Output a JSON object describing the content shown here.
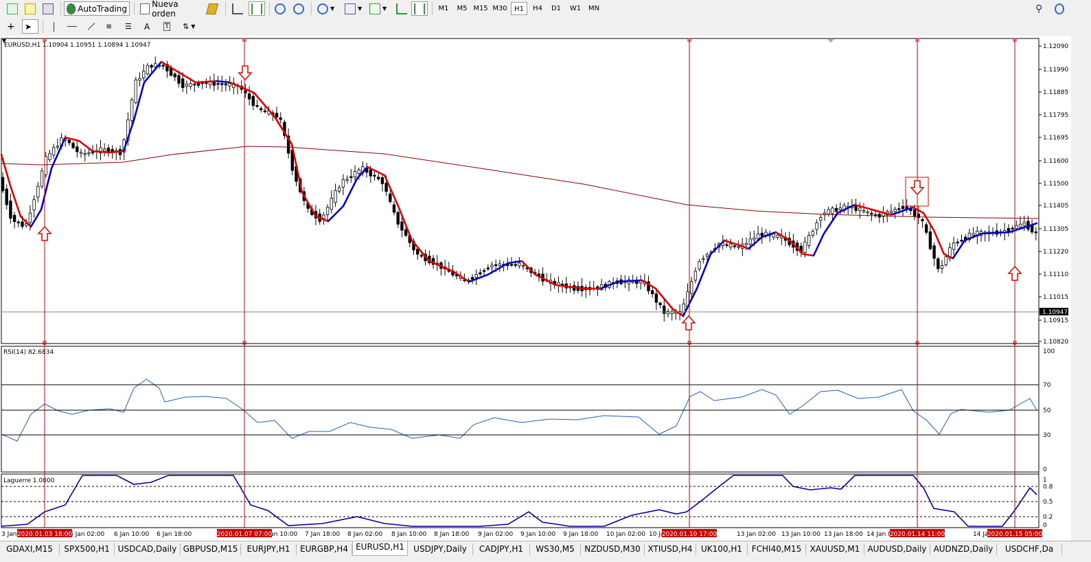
{
  "toolbar_top": {
    "autotrading_label": "AutoTrading",
    "new_order_label": "Nueva orden",
    "timeframes": [
      "M1",
      "M5",
      "M15",
      "M30",
      "H1",
      "H4",
      "D1",
      "W1",
      "MN"
    ],
    "active_timeframe": "H1"
  },
  "toolbar_draw": {
    "text_tool_label": "A",
    "text_label_tool_label": "T"
  },
  "chart": {
    "header": "EURUSD,H1  1.10904 1.10951 1.10894 1.10947",
    "current_price": "1.10947",
    "price_ticks": [
      "1.12090",
      "1.11990",
      "1.11885",
      "1.11795",
      "1.11695",
      "1.11600",
      "1.11500",
      "1.11405",
      "1.11305",
      "1.11220",
      "1.11110",
      "1.11015",
      "1.10915",
      "1.10820"
    ],
    "rsi_label": "RSI(14) 82.6834",
    "rsi_ticks": [
      "100",
      "70",
      "50",
      "30",
      "0"
    ],
    "laguerre_label": "Laguerre 1.0000",
    "laguerre_ticks": [
      "1",
      "0.8",
      "0.5",
      "0.2",
      "0"
    ],
    "time_labels": [
      "3 Jan 16:00",
      "6 Jan 02:00",
      "6 Jan 10:00",
      "6 Jan 18:00",
      "7 Jan 10:00",
      "7 Jan 18:00",
      "8 Jan 02:00",
      "8 Jan 10:00",
      "8 Jan 18:00",
      "9 Jan 02:00",
      "9 Jan 10:00",
      "9 Jan 18:00",
      "10 Jan 02:00",
      "10 Jan 10:00",
      "13 Jan 02:00",
      "13 Jan 10:00",
      "13 Jan 18:00",
      "14 Jan 02:00",
      "14 Jan 18:00"
    ],
    "vline_labels": [
      "2020.01.03 18:00",
      "2020.01.07 07:00",
      "2020.01.10 17:00",
      "2020.01.14 11:00",
      "2020.01.15 05:00"
    ],
    "colors": {
      "uptrend": "#0000cc",
      "downtrend": "#e00000",
      "ma": "#8b0000",
      "rsi": "#1f5fbf",
      "laguerre": "#0000aa",
      "vline": "#cc0000"
    }
  },
  "symbol_tabs": [
    "GDAXI,M15",
    "SPX500,H1",
    "USDCAD,Daily",
    "GBPUSD,M15",
    "EURJPY,H1",
    "EURGBP,H4",
    "EURUSD,H1",
    "USDJPY,Daily",
    "CADJPY,H1",
    "WS30,M5",
    "NZDUSD,M30",
    "XTIUSD,H4",
    "UK100,H1",
    "FCHI40,M15",
    "XAUUSD,M1",
    "AUDUSD,Daily",
    "AUDNZD,Daily",
    "USDCHF,Da"
  ],
  "active_tab": "EURUSD,H1"
}
